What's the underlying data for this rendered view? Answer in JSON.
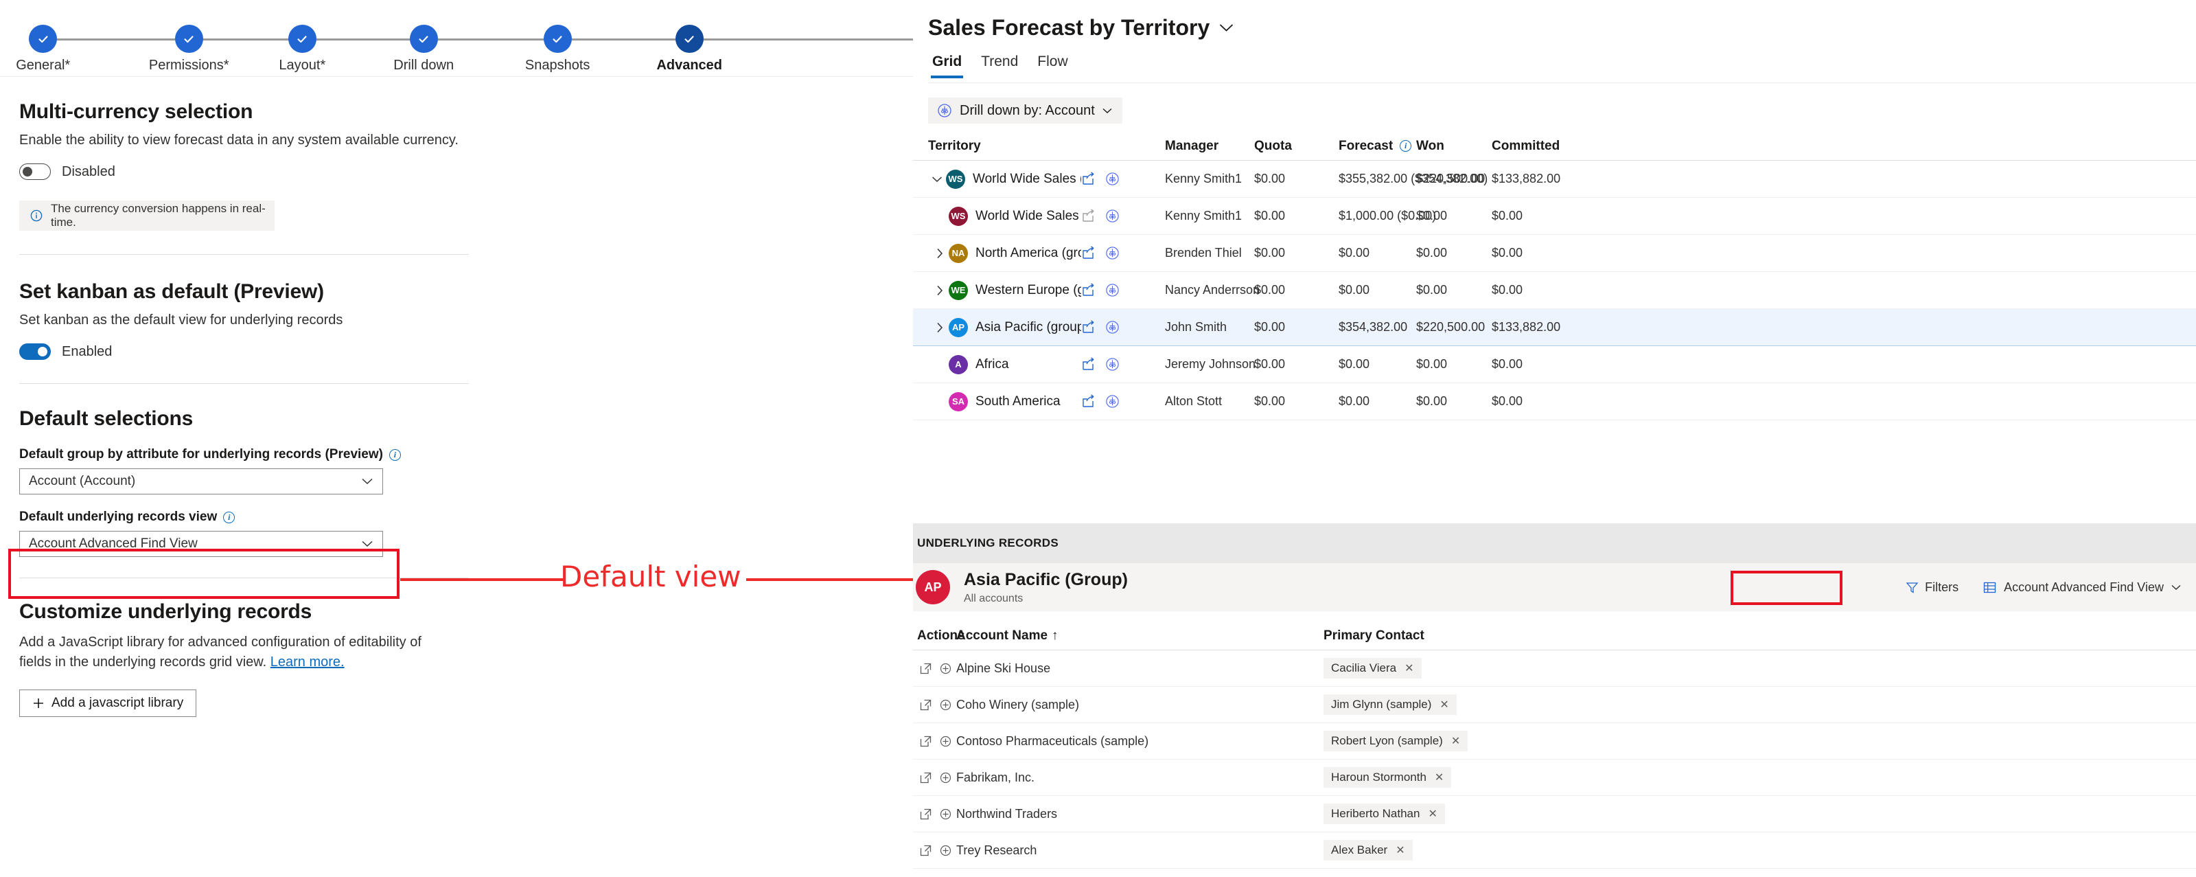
{
  "stepper": {
    "steps": [
      {
        "label": "General*",
        "state": "done"
      },
      {
        "label": "Permissions*",
        "state": "done"
      },
      {
        "label": "Layout*",
        "state": "done"
      },
      {
        "label": "Drill down",
        "state": "done"
      },
      {
        "label": "Snapshots",
        "state": "done"
      },
      {
        "label": "Advanced",
        "state": "current"
      }
    ]
  },
  "settings": {
    "multicurrency": {
      "title": "Multi-currency selection",
      "desc": "Enable the ability to view forecast data in any system available currency.",
      "toggle_label": "Disabled",
      "toggle_on": false,
      "info": "The currency conversion happens in real-time."
    },
    "kanban": {
      "title": "Set kanban as default (Preview)",
      "desc": "Set kanban as the default view for underlying records",
      "toggle_label": "Enabled",
      "toggle_on": true
    },
    "default_selections": {
      "title": "Default selections",
      "group_by_label": "Default group by attribute for underlying records (Preview)",
      "group_by_value": "Account (Account)",
      "records_view_label": "Default underlying records view",
      "records_view_value": "Account Advanced Find View"
    },
    "customize": {
      "title": "Customize underlying records",
      "desc_part1": "Add a JavaScript library for advanced configuration of editability of fields in the underlying records grid view.",
      "desc_link": "Learn more.",
      "add_button": "Add a javascript library"
    }
  },
  "annotation": {
    "text": "Default view",
    "color": "#ee2a2a"
  },
  "forecast": {
    "title": "Sales Forecast by Territory",
    "tabs": [
      {
        "label": "Grid",
        "active": true
      },
      {
        "label": "Trend",
        "active": false
      },
      {
        "label": "Flow",
        "active": false
      }
    ],
    "drill_down_chip": "Drill down by: Account",
    "columns": [
      "Territory",
      "Manager",
      "Quota",
      "Forecast",
      "Won",
      "Committed"
    ],
    "rows": [
      {
        "initials": "WS",
        "color": "#0b5e6e",
        "name": "World Wide Sales (group",
        "indent": 0,
        "chevron": "down",
        "manager": "Kenny Smith1",
        "quota": "$0.00",
        "forecast": "$355,382.00 ($354,382.00)",
        "won": "$220,500.00",
        "committed": "$133,882.00",
        "selected": false
      },
      {
        "initials": "WS",
        "color": "#8f1634",
        "name": "World Wide Sales",
        "indent": 1,
        "chevron": "none",
        "manager": "Kenny Smith1",
        "quota": "$0.00",
        "forecast": "$1,000.00 ($0.00)",
        "won": "$0.00",
        "committed": "$0.00",
        "selected": false
      },
      {
        "initials": "NA",
        "color": "#ab7a08",
        "name": "North America (grou",
        "indent": 1,
        "chevron": "right",
        "manager": "Brenden Thiel",
        "quota": "$0.00",
        "forecast": "$0.00",
        "won": "$0.00",
        "committed": "$0.00",
        "selected": false
      },
      {
        "initials": "WE",
        "color": "#0c7712",
        "name": "Western Europe (gro",
        "indent": 1,
        "chevron": "right",
        "manager": "Nancy Anderrson",
        "quota": "$0.00",
        "forecast": "$0.00",
        "won": "$0.00",
        "committed": "$0.00",
        "selected": false
      },
      {
        "initials": "AP",
        "color": "#0f8ce0",
        "name": "Asia Pacific (group)",
        "indent": 1,
        "chevron": "right",
        "manager": "John Smith",
        "quota": "$0.00",
        "forecast": "$354,382.00",
        "won": "$220,500.00",
        "committed": "$133,882.00",
        "selected": true
      },
      {
        "initials": "A",
        "color": "#6b2fa5",
        "name": "Africa",
        "indent": 1,
        "chevron": "none",
        "manager": "Jeremy Johnson",
        "quota": "$0.00",
        "forecast": "$0.00",
        "won": "$0.00",
        "committed": "$0.00",
        "selected": false
      },
      {
        "initials": "SA",
        "color": "#d42cb0",
        "name": "South America",
        "indent": 1,
        "chevron": "none",
        "manager": "Alton Stott",
        "quota": "$0.00",
        "forecast": "$0.00",
        "won": "$0.00",
        "committed": "$0.00",
        "selected": false
      }
    ]
  },
  "underlying": {
    "band_label": "UNDERLYING RECORDS",
    "avatar_initials": "AP",
    "avatar_color": "#d91c3a",
    "title": "Asia Pacific (Group)",
    "subtitle": "All accounts",
    "filters_label": "Filters",
    "view_label": "Account Advanced Find View",
    "columns": [
      "Actions",
      "Account Name",
      "Primary Contact"
    ],
    "sort_indicator": "↑",
    "rows": [
      {
        "account": "Alpine Ski House",
        "contact": "Cacilia Viera"
      },
      {
        "account": "Coho Winery (sample)",
        "contact": "Jim Glynn (sample)"
      },
      {
        "account": "Contoso Pharmaceuticals (sample)",
        "contact": "Robert Lyon (sample)"
      },
      {
        "account": "Fabrikam, Inc.",
        "contact": "Haroun Stormonth"
      },
      {
        "account": "Northwind Traders",
        "contact": "Heriberto Nathan"
      },
      {
        "account": "Trey Research",
        "contact": "Alex Baker"
      }
    ]
  }
}
